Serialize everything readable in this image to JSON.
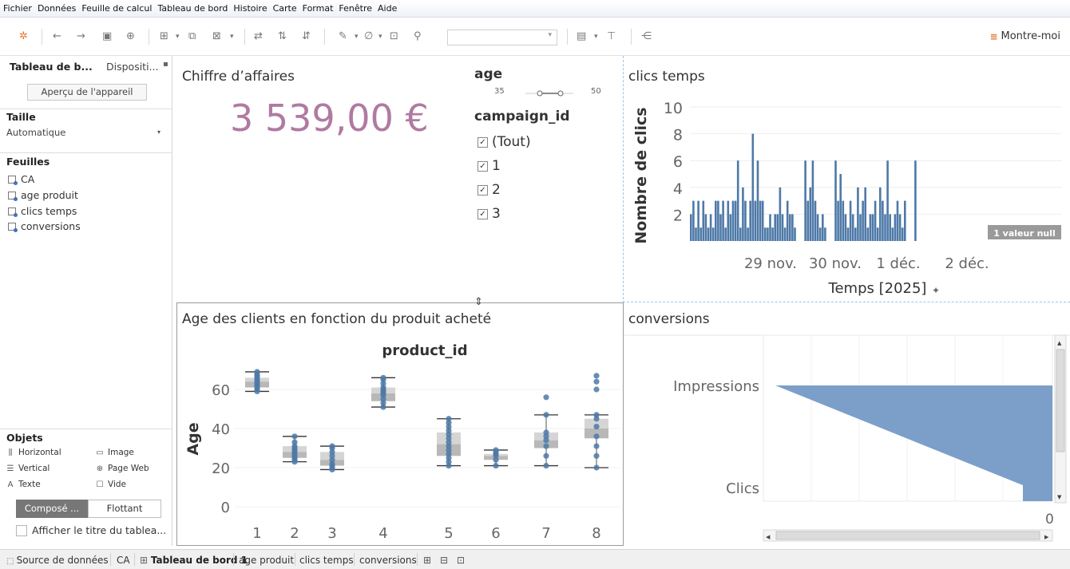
{
  "menu": [
    "Fichier",
    "Données",
    "Feuille de calcul",
    "Tableau de bord",
    "Histoire",
    "Carte",
    "Format",
    "Fenêtre",
    "Aide"
  ],
  "toolbar": {
    "show_me_label": "Montre-moi",
    "select_value": ""
  },
  "left_panel": {
    "tabs": [
      "Tableau de b...",
      "Dispositi..."
    ],
    "device_preview_label": "Aperçu de l'appareil",
    "size_section": "Taille",
    "size_value": "Automatique",
    "sheets_section": "Feuilles",
    "sheets": [
      "CA",
      "age produit",
      "clics temps",
      "conversions"
    ],
    "objects_section": "Objets",
    "objects": [
      {
        "label": "Horizontal",
        "icon": "horizontal-container-icon"
      },
      {
        "label": "Image",
        "icon": "image-icon"
      },
      {
        "label": "Vertical",
        "icon": "vertical-container-icon"
      },
      {
        "label": "Page Web",
        "icon": "web-page-icon"
      },
      {
        "label": "Texte",
        "icon": "text-icon"
      },
      {
        "label": "Vide",
        "icon": "blank-icon"
      }
    ],
    "layout_toggle": [
      "Composé ...",
      "Flottant"
    ],
    "show_title_label": "Afficher le titre du tablea..."
  },
  "dashboard": {
    "ca": {
      "title": "Chiffre d’affaires",
      "value": "3 539,00 €",
      "value_color": "#b07aa1"
    },
    "age_filter": {
      "title": "age",
      "min": "35",
      "max": "50"
    },
    "campaign_filter": {
      "title": "campaign_id",
      "options": [
        "(Tout)",
        "1",
        "2",
        "3"
      ]
    },
    "clics_title": "clics temps",
    "age_title": "Age des clients en fonction du produit acheté",
    "conversions_title": "conversions"
  },
  "chart_data": [
    {
      "type": "bar",
      "name": "clics temps",
      "title": "clics temps",
      "xlabel": "Temps [2025]",
      "ylabel": "Nombre de clics",
      "ylim": [
        0,
        10
      ],
      "yticks": [
        2,
        4,
        6,
        8,
        10
      ],
      "xtick_labels": [
        "29 nov.",
        "30 nov.",
        "1 déc.",
        "2 déc."
      ],
      "null_badge": "1 valeur null",
      "bar_color": "#4e79a7",
      "segments": [
        [
          2,
          3,
          1,
          3,
          1,
          3,
          2,
          1,
          2,
          1,
          3,
          3,
          2,
          3,
          1,
          3,
          2,
          3,
          3,
          6,
          1,
          4,
          3,
          1,
          3,
          8,
          3,
          6,
          3,
          3,
          1,
          1,
          2,
          1,
          2,
          2,
          4,
          2,
          1,
          3,
          2,
          2,
          1
        ],
        [
          6,
          3,
          4,
          6,
          3,
          2,
          1,
          2,
          1
        ],
        [
          6,
          3,
          5,
          3,
          2,
          1,
          3,
          2,
          1,
          4,
          2,
          3,
          4,
          1,
          2,
          2,
          3,
          1,
          4,
          3,
          2,
          6,
          2,
          1,
          2,
          3,
          2,
          1,
          3
        ],
        [
          6
        ]
      ]
    },
    {
      "type": "box",
      "name": "age produit",
      "title": "product_id",
      "ylabel": "Age",
      "ylim": [
        0,
        75
      ],
      "yticks": [
        0,
        20,
        40,
        60
      ],
      "categories": [
        "1",
        "2",
        "3",
        "4",
        "5",
        "6",
        "7",
        "8"
      ],
      "boxes": [
        {
          "min": 59,
          "q1": 61,
          "median": 64,
          "q3": 66,
          "max": 69,
          "points": [
            59,
            60,
            61,
            62,
            63,
            64,
            65,
            66,
            67,
            68,
            69
          ]
        },
        {
          "min": 23,
          "q1": 25,
          "median": 28,
          "q3": 31,
          "max": 36,
          "points": [
            23,
            24,
            25,
            26,
            27,
            28,
            29,
            30,
            31,
            33,
            36
          ]
        },
        {
          "min": 19,
          "q1": 21,
          "median": 24,
          "q3": 28,
          "max": 31,
          "points": [
            19,
            20,
            21,
            22,
            24,
            26,
            28,
            30,
            31
          ]
        },
        {
          "min": 51,
          "q1": 54,
          "median": 58,
          "q3": 61,
          "max": 66,
          "points": [
            51,
            53,
            55,
            57,
            58,
            59,
            60,
            61,
            63,
            65,
            66
          ]
        },
        {
          "min": 21,
          "q1": 26,
          "median": 32,
          "q3": 38,
          "max": 45,
          "points": [
            21,
            23,
            25,
            27,
            29,
            31,
            33,
            35,
            37,
            39,
            41,
            43,
            45
          ]
        },
        {
          "min": 21,
          "q1": 24,
          "median": 26,
          "q3": 27,
          "max": 29,
          "points": [
            21,
            24,
            26,
            27,
            28,
            29
          ]
        },
        {
          "min": 21,
          "q1": 30,
          "median": 34,
          "q3": 38,
          "max": 47,
          "points": [
            21,
            26,
            31,
            34,
            36,
            38,
            47,
            56
          ]
        },
        {
          "min": 20,
          "q1": 35,
          "median": 40,
          "q3": 45,
          "max": 47,
          "points": [
            20,
            26,
            31,
            36,
            41,
            45,
            47,
            60,
            64,
            67
          ]
        }
      ],
      "point_color": "#4e79a7"
    },
    {
      "type": "area",
      "name": "conversions",
      "title": "conversions",
      "categories": [
        "Impressions",
        "Clics"
      ],
      "x_axis_label": "0",
      "fill_color": "#7b9fc9"
    }
  ],
  "bottom_tabs": [
    {
      "label": "Source de données",
      "icon": "datasource-icon"
    },
    {
      "label": "CA"
    },
    {
      "label": "Tableau de bord 1",
      "icon": "dashboard-icon",
      "active": true
    },
    {
      "label": "age produit"
    },
    {
      "label": "clics temps"
    },
    {
      "label": "conversions"
    }
  ]
}
